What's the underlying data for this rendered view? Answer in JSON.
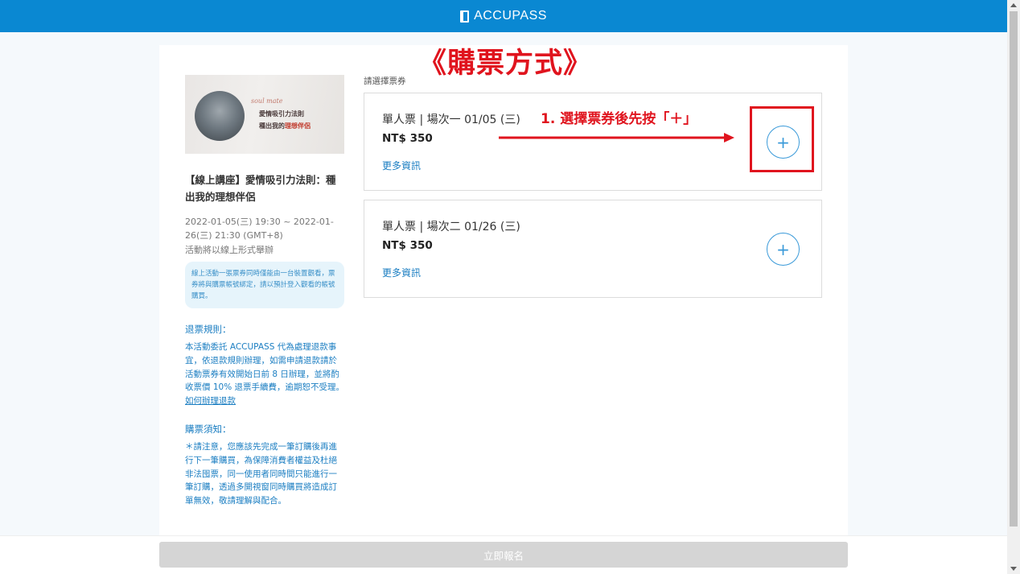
{
  "header": {
    "brand": "ACCUPASS",
    "brand_color": "#0a88d2"
  },
  "overlay_title": "《購票方式》",
  "annotation": {
    "text": "1. 選擇票券後先按「＋」",
    "color": "#e0141e"
  },
  "event": {
    "banner": {
      "script": "soul mate",
      "line1": "愛情吸引力法則",
      "line2_prefix": "種出我的",
      "line2_highlight": "理想伴侶"
    },
    "title": "【線上講座】愛情吸引力法則：種出我的理想伴侶",
    "date": "2022-01-05(三) 19:30 ~ 2022-01-26(三) 21:30 (GMT+8)",
    "mode": "活動將以線上形式舉辦",
    "notice": "線上活動一張票券同時僅能由一台裝置觀看，票券將與購票帳號綁定，請以預計登入觀看的帳號購買。",
    "refund": {
      "heading": "退票規則：",
      "body": "本活動委託 ACCUPASS 代為處理退款事宜，依退款規則辦理，如需申請退款請於活動票券有效開始日前 8 日辦理，並將酌收票價 10% 退票手續費，逾期恕不受理。",
      "link": "如何辦理退款"
    },
    "purchase": {
      "heading": "購票須知：",
      "body": "＊請注意，您應該先完成一筆訂購後再進行下一筆購買，為保障消費者權益及杜絕非法囤票，同一使用者同時間只能進行一筆訂購，透過多開視窗同時購買將造成訂單無效，敬請理解與配合。"
    }
  },
  "tickets": {
    "label": "請選擇票券",
    "items": [
      {
        "name": "單人票 | 場次一 01/05 (三)",
        "price": "NT$ 350",
        "more": "更多資訊",
        "plus": "+"
      },
      {
        "name": "單人票 | 場次二 01/26 (三)",
        "price": "NT$ 350",
        "more": "更多資訊",
        "plus": "+"
      }
    ]
  },
  "submit_label": "立即報名"
}
